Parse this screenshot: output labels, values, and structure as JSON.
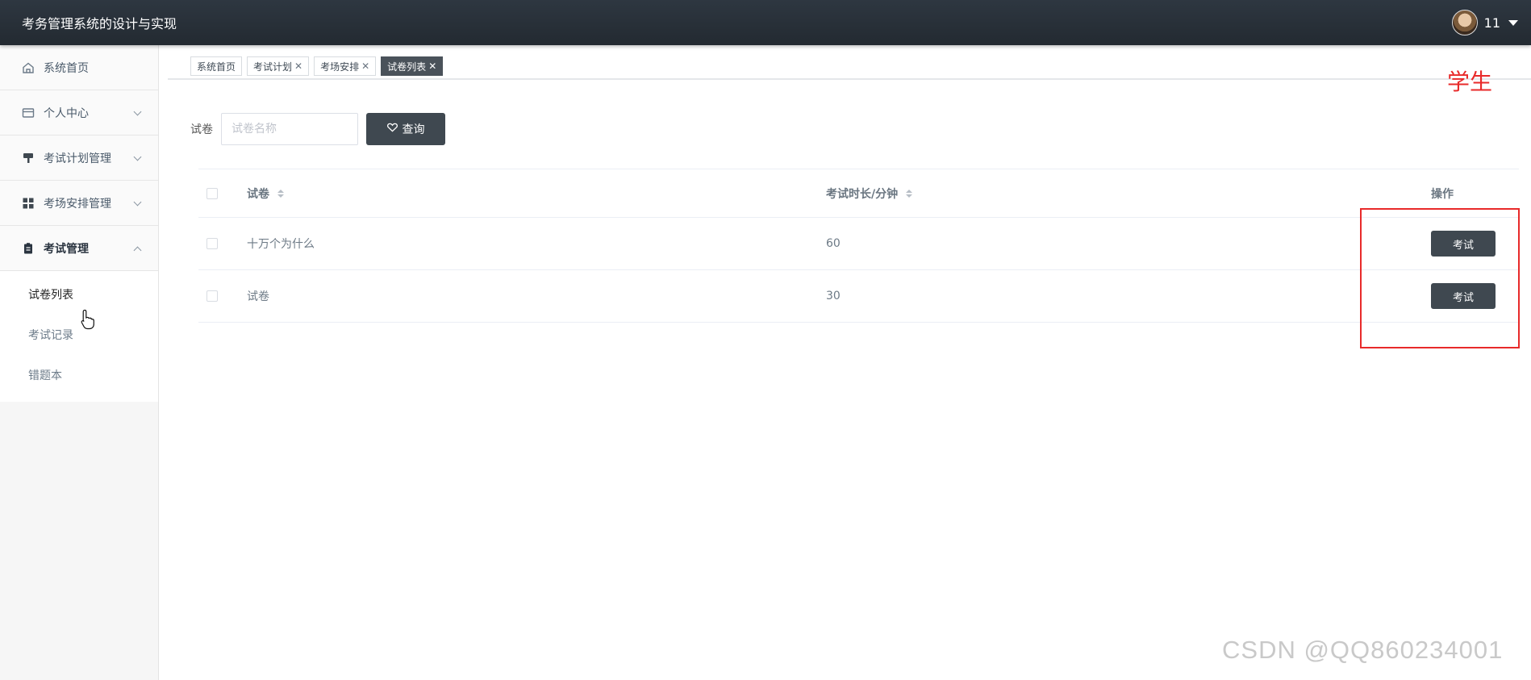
{
  "header": {
    "title": "考务管理系统的设计与实现",
    "username": "11"
  },
  "sidebar": {
    "items": [
      {
        "label": "系统首页"
      },
      {
        "label": "个人中心"
      },
      {
        "label": "考试计划管理"
      },
      {
        "label": "考场安排管理"
      },
      {
        "label": "考试管理"
      }
    ],
    "subitems": [
      {
        "label": "试卷列表"
      },
      {
        "label": "考试记录"
      },
      {
        "label": "错题本"
      }
    ]
  },
  "tabs": [
    {
      "label": "系统首页"
    },
    {
      "label": "考试计划"
    },
    {
      "label": "考场安排"
    },
    {
      "label": "试卷列表"
    }
  ],
  "tab_close_glyph": "✕",
  "role_label": "学生",
  "search": {
    "label": "试卷",
    "placeholder": "试卷名称",
    "button": "查询"
  },
  "table": {
    "columns": {
      "name": "试卷",
      "duration": "考试时长/分钟",
      "actions": "操作"
    },
    "rows": [
      {
        "name": "十万个为什么",
        "duration": "60",
        "action": "考试"
      },
      {
        "name": "试卷",
        "duration": "30",
        "action": "考试"
      }
    ]
  },
  "watermark": "CSDN @QQ860234001",
  "colors": {
    "header_bg": "#2b333b",
    "button_bg": "#3f4850",
    "highlight": "#e82a2a"
  }
}
